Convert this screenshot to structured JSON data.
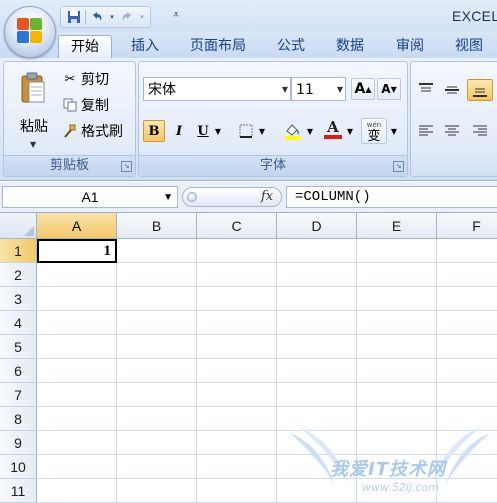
{
  "window": {
    "app_title": "EXCEL"
  },
  "quick_access": {
    "items": [
      "save-icon",
      "undo-icon",
      "redo-icon"
    ]
  },
  "tabs": [
    {
      "label": "开始",
      "active": true
    },
    {
      "label": "插入"
    },
    {
      "label": "页面布局"
    },
    {
      "label": "公式"
    },
    {
      "label": "数据"
    },
    {
      "label": "审阅"
    },
    {
      "label": "视图"
    }
  ],
  "clipboard": {
    "paste_label": "粘贴",
    "cut_label": "剪切",
    "copy_label": "复制",
    "format_painter_label": "格式刷",
    "group_label": "剪贴板"
  },
  "font": {
    "font_name": "宋体",
    "font_size": "11",
    "bold": "B",
    "italic": "I",
    "underline": "U",
    "grow": "A",
    "shrink": "A",
    "font_color_glyph": "A",
    "phonetic_glyph": "wén",
    "phonetic_char": "变",
    "group_label": "字体"
  },
  "formula_bar": {
    "name_box": "A1",
    "fx_label": "fx",
    "formula": "=COLUMN()"
  },
  "sheet": {
    "columns": [
      "A",
      "B",
      "C",
      "D",
      "E",
      "F"
    ],
    "rows": [
      "1",
      "2",
      "3",
      "4",
      "5",
      "6",
      "7",
      "8",
      "9",
      "10",
      "11"
    ],
    "selected_cell": "A1",
    "a1_value": "1"
  },
  "watermark": {
    "text": "我爱IT技术网",
    "url": "www.52ij.com"
  },
  "colors": {
    "accent": "#15428b",
    "selected_header": "#f2c96a",
    "font_color_bar": "#e01b1b",
    "highlight_bar": "#ffff00"
  }
}
